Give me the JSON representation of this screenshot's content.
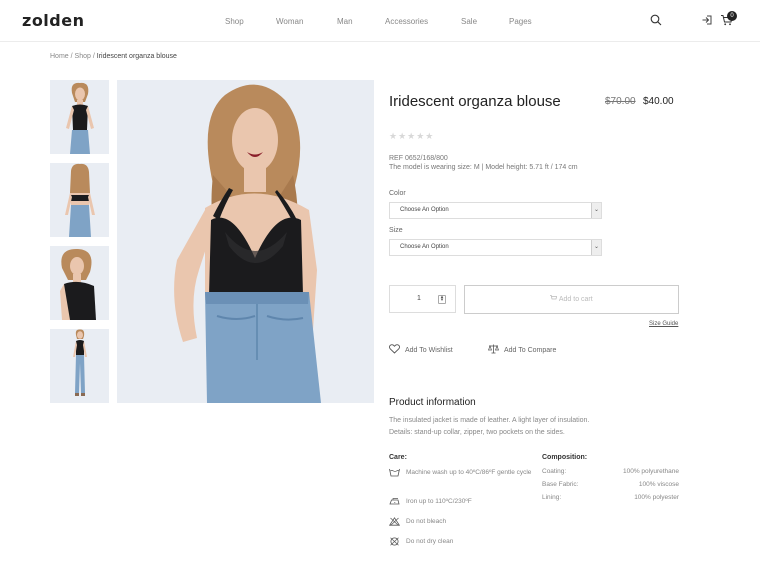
{
  "header": {
    "logo": "zolden",
    "nav": [
      "Shop",
      "Woman",
      "Man",
      "Accessories",
      "Sale",
      "Pages"
    ],
    "cart_count": "0"
  },
  "breadcrumb": {
    "home": "Home",
    "sep": "/",
    "shop": "Shop",
    "current": "Iridescent organza blouse"
  },
  "product": {
    "title": "Iridescent organza blouse",
    "price_old": "$70.00",
    "price_new": "$40.00",
    "rating_stars": "★★★★★",
    "ref": "REF 0652/168/800",
    "model_info": "The model is wearing size: M | Model height: 5.71 ft / 174 cm",
    "color_label": "Color",
    "color_select": "Choose An Option",
    "size_label": "Size",
    "size_select": "Choose An Option",
    "quantity": "1",
    "add_to_cart": "Add to cart",
    "size_guide": "Size Guide",
    "wishlist": "Add To Wishlist",
    "compare": "Add To Compare"
  },
  "info": {
    "title": "Product information",
    "line1": "The insulated jacket is made of leather. A light layer of insulation.",
    "line2": "Details: stand-up collar, zipper, two pockets on the sides.",
    "care_title": "Care:",
    "care": [
      {
        "icon": "wash-icon",
        "text": "Machine wash up to 40ºC/86ºF gentle cycle"
      },
      {
        "icon": "iron-icon",
        "text": "Iron up to 110ºC/230ºF"
      },
      {
        "icon": "no-bleach-icon",
        "text": "Do not bleach"
      },
      {
        "icon": "no-dry-clean-icon",
        "text": "Do not dry clean"
      }
    ],
    "composition_title": "Composition:",
    "composition": [
      {
        "label": "Coating:",
        "value": "100% polyurethane"
      },
      {
        "label": "Base Fabric:",
        "value": "100% viscose"
      },
      {
        "label": "Lining:",
        "value": "100% polyester"
      }
    ]
  },
  "colors": {
    "text_dark": "#222222",
    "image_bg": "#e9edf3",
    "bodysuit": "#1b1b1d",
    "denim": "#7fa3c6"
  }
}
